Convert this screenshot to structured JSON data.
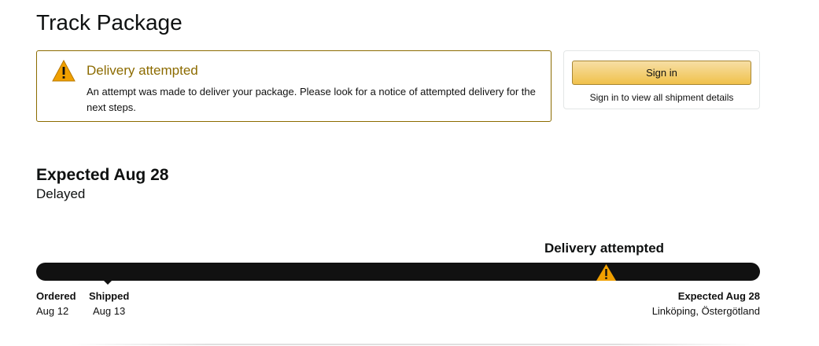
{
  "page": {
    "title": "Track Package"
  },
  "alert": {
    "title": "Delivery attempted",
    "message": "An attempt was made to deliver your package. Please look for a notice of attempted delivery for the next steps.",
    "icon": "warning-icon",
    "accent_color": "#8c6b00"
  },
  "signin": {
    "button_label": "Sign in",
    "hint": "Sign in to view all shipment details",
    "button_color": "#f0c14b"
  },
  "delivery": {
    "expected_heading": "Expected Aug 28",
    "status": "Delayed"
  },
  "tracker": {
    "current_step": "Delivery attempted",
    "current_step_icon": "warning-icon",
    "steps": [
      {
        "label": "Ordered",
        "detail": "Aug 12"
      },
      {
        "label": "Shipped",
        "detail": "Aug 13"
      },
      {
        "label": "Expected Aug 28",
        "detail": "Linköping, Östergötland"
      }
    ],
    "warning_color": "#f0a000"
  }
}
